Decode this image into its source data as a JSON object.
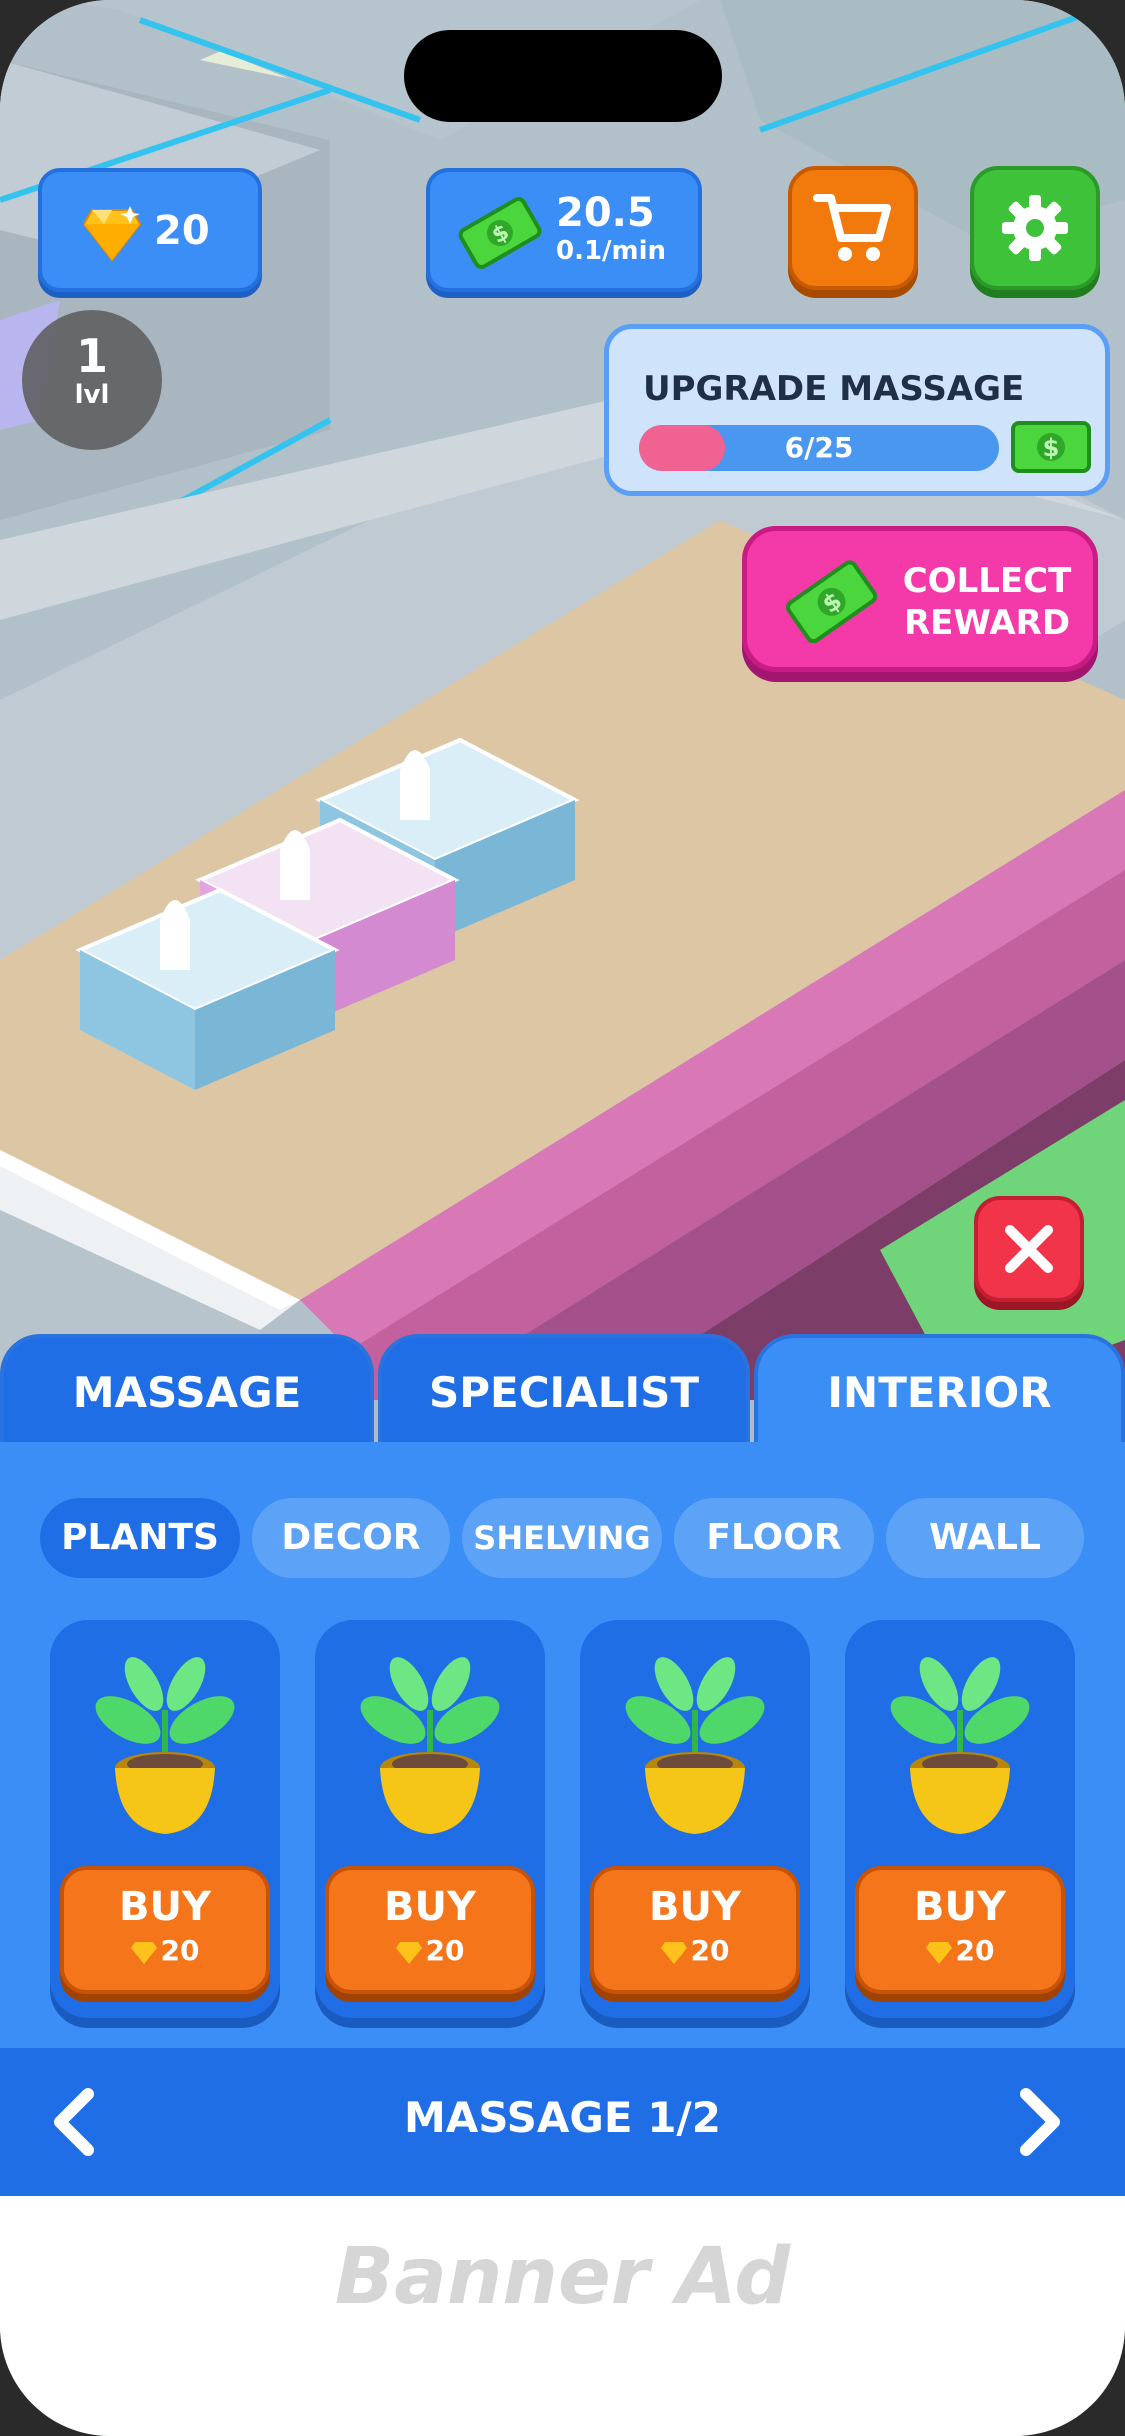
{
  "hud": {
    "gems": "20",
    "cash": "20.5",
    "cash_rate": "0.1/min",
    "level_number": "1",
    "level_unit": "lvl"
  },
  "upgrade": {
    "title": "UPGRADE MASSAGE",
    "progress_text": "6/25",
    "progress_fraction": 0.24
  },
  "collect": {
    "line1": "COLLECT",
    "line2": "REWARD"
  },
  "tabs": [
    {
      "label": "MASSAGE",
      "active": false
    },
    {
      "label": "SPECIALIST",
      "active": false
    },
    {
      "label": "INTERIOR",
      "active": true
    }
  ],
  "categories": [
    {
      "label": "PLANTS",
      "active": true
    },
    {
      "label": "DECOR",
      "active": false
    },
    {
      "label": "SHELVING",
      "active": false
    },
    {
      "label": "FLOOR",
      "active": false
    },
    {
      "label": "WALL",
      "active": false
    }
  ],
  "items": [
    {
      "buy_label": "BUY",
      "price": "20",
      "icon": "potted-plant-icon"
    },
    {
      "buy_label": "BUY",
      "price": "20",
      "icon": "potted-plant-icon"
    },
    {
      "buy_label": "BUY",
      "price": "20",
      "icon": "potted-plant-icon"
    },
    {
      "buy_label": "BUY",
      "price": "20",
      "icon": "potted-plant-icon"
    }
  ],
  "pager": {
    "title": "MASSAGE 1/2"
  },
  "ad": {
    "label": "Banner Ad"
  },
  "colors": {
    "accent_blue": "#3a8ef5",
    "dark_blue": "#1f6ee6",
    "buy_orange": "#f5751b",
    "collect_pink": "#f33aa8",
    "progress_pink": "#f06292",
    "close_red": "#f2344a",
    "settings_green": "#3dc23a"
  }
}
